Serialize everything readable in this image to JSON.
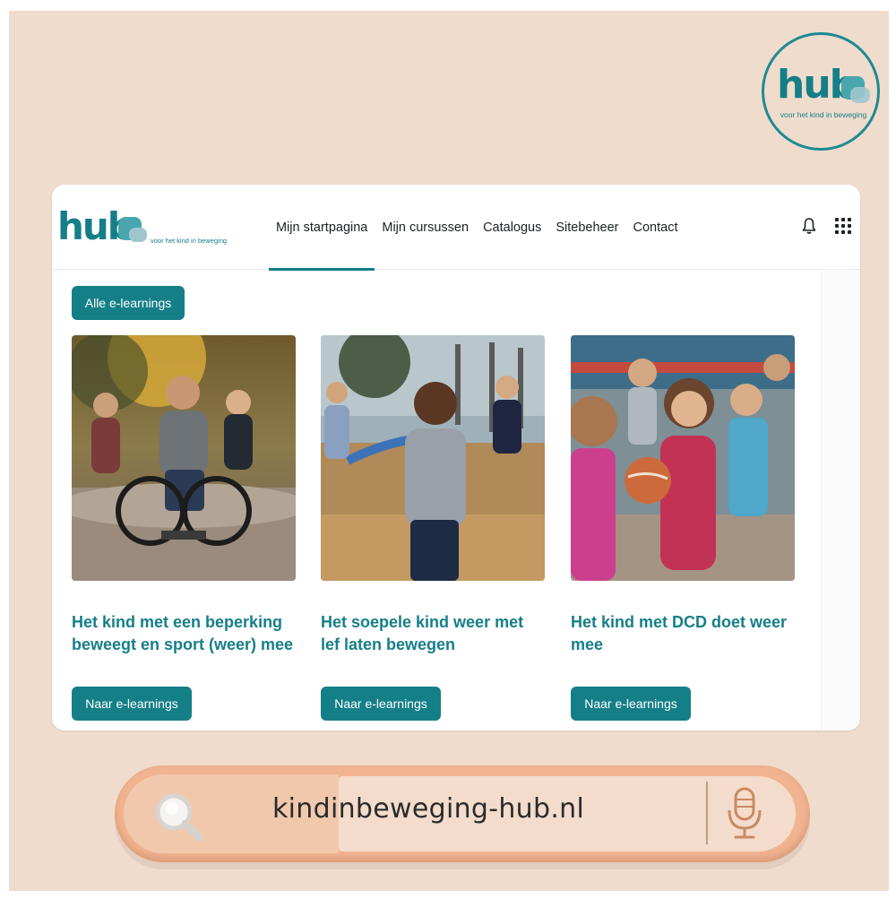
{
  "badge": {
    "word": "hub",
    "tagline": "voor het kind in beweging"
  },
  "header": {
    "logo_word": "hub",
    "logo_tagline": "voor het kind in beweging",
    "nav": [
      {
        "label": "Mijn startpagina",
        "active": true
      },
      {
        "label": "Mijn cursussen",
        "active": false
      },
      {
        "label": "Catalogus",
        "active": false
      },
      {
        "label": "Sitebeheer",
        "active": false
      },
      {
        "label": "Contact",
        "active": false
      }
    ],
    "icons": [
      "bell-icon",
      "app-grid-icon"
    ]
  },
  "main": {
    "all_button": "Alle e-learnings",
    "courses": [
      {
        "title": "Het kind met een beperking beweegt en sport (weer) mee",
        "button": "Naar e-learnings",
        "image": "child-in-wheelchair-park-photo"
      },
      {
        "title": "Het soepele kind weer met lef laten bewegen",
        "button": "Naar e-learnings",
        "image": "child-running-playground-photo"
      },
      {
        "title": "Het kind met DCD doet weer mee",
        "button": "Naar e-learnings",
        "image": "girl-holding-ball-photo"
      }
    ]
  },
  "search": {
    "url": "kindinbeweging-hub.nl",
    "icons": [
      "magnifier-icon",
      "microphone-icon"
    ]
  },
  "colors": {
    "brand": "#157f88",
    "background": "#efdccd",
    "pill": "#f1b390"
  }
}
